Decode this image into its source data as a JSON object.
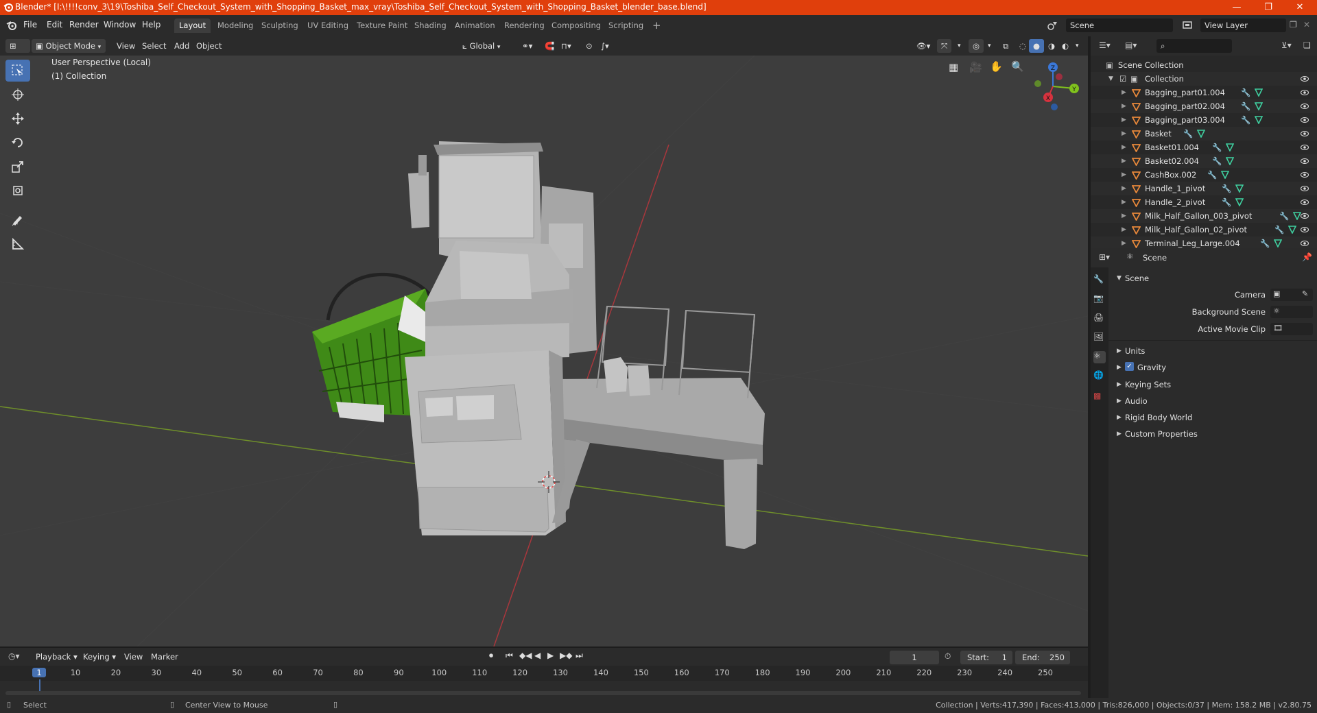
{
  "window": {
    "title": "Blender* [I:\\!!!!conv_3\\19\\Toshiba_Self_Checkout_System_with_Shopping_Basket_max_vray\\Toshiba_Self_Checkout_System_with_Shopping_Basket_blender_base.blend]",
    "minimize": "—",
    "maximize": "❐",
    "close": "✕"
  },
  "menu": [
    "File",
    "Edit",
    "Render",
    "Window",
    "Help"
  ],
  "workspaces": [
    "Layout",
    "Modeling",
    "Sculpting",
    "UV Editing",
    "Texture Paint",
    "Shading",
    "Animation",
    "Rendering",
    "Compositing",
    "Scripting"
  ],
  "active_workspace": "Layout",
  "scene_field": "Scene",
  "view_layer_field": "View Layer",
  "viewport_header": {
    "mode": "Object Mode",
    "menus": [
      "View",
      "Select",
      "Add",
      "Object"
    ],
    "orientation": "Global"
  },
  "viewport": {
    "perspective_label": "User Perspective (Local)",
    "collection_label": "(1) Collection",
    "gizmo_axes": {
      "x": "X",
      "y": "Y",
      "z": "Z"
    }
  },
  "outliner": {
    "root": "Scene Collection",
    "collection": "Collection",
    "items": [
      "Bagging_part01.004",
      "Bagging_part02.004",
      "Bagging_part03.004",
      "Basket",
      "Basket01.004",
      "Basket02.004",
      "CashBox.002",
      "Handle_1_pivot",
      "Handle_2_pivot",
      "Milk_Half_Gallon_003_pivot",
      "Milk_Half_Gallon_02_pivot",
      "Terminal_Leg_Large.004"
    ]
  },
  "properties": {
    "context": "Scene",
    "panel_title": "Scene",
    "fields": {
      "camera": "Camera",
      "background_scene": "Background Scene",
      "active_movie_clip": "Active Movie Clip"
    },
    "sections": {
      "units": "Units",
      "gravity": "Gravity",
      "keying_sets": "Keying Sets",
      "audio": "Audio",
      "rigid_body_world": "Rigid Body World",
      "custom_properties": "Custom Properties"
    },
    "gravity_checked": true
  },
  "timeline": {
    "menus": {
      "playback": "Playback",
      "keying": "Keying",
      "view": "View",
      "marker": "Marker"
    },
    "current_frame": "1",
    "start_label": "Start:",
    "start_value": "1",
    "end_label": "End:",
    "end_value": "250",
    "ticks": [
      "1",
      "10",
      "20",
      "30",
      "40",
      "50",
      "60",
      "70",
      "80",
      "90",
      "100",
      "110",
      "120",
      "130",
      "140",
      "150",
      "160",
      "170",
      "180",
      "190",
      "200",
      "210",
      "220",
      "230",
      "240",
      "250"
    ]
  },
  "statusbar": {
    "left": "Select",
    "middle": "Center View to Mouse",
    "right": "Collection | Verts:417,390 | Faces:413,000 | Tris:826,000 | Objects:0/37 | Mem: 158.2 MB | v2.80.75"
  },
  "colors": {
    "accent": "#4772b3",
    "titlebar": "#e03f0c",
    "basket": "#3f8a17",
    "model": "#b8b8b8",
    "x_axis": "#d6323e",
    "y_axis": "#80c21d",
    "z_axis": "#3b78d8"
  }
}
